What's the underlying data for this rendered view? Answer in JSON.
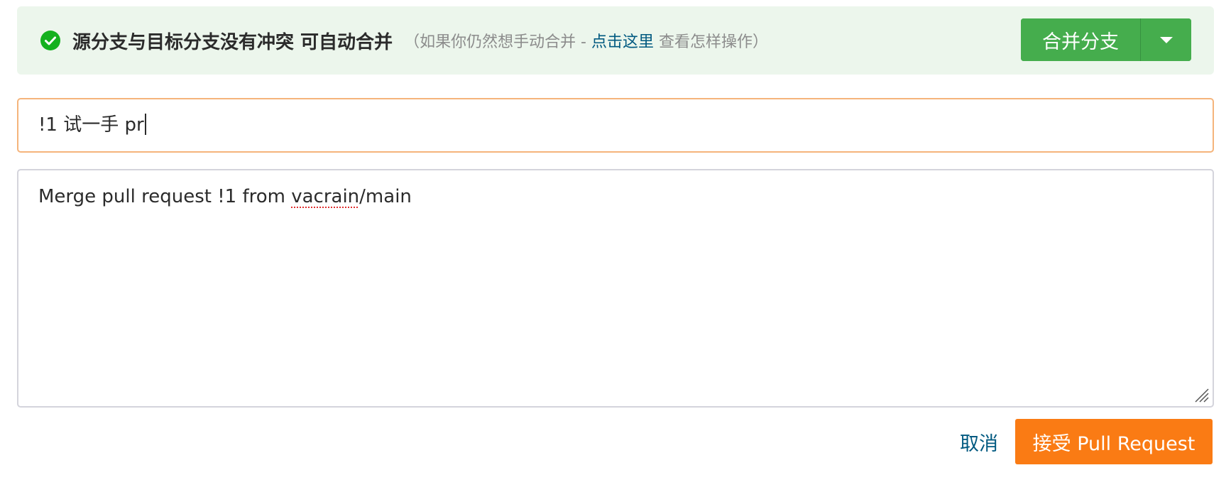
{
  "colors": {
    "banner_bg": "#ecf6ec",
    "success_green": "#45ad4d",
    "check_icon_green": "#14b11e",
    "link_blue": "#005980",
    "accent_orange": "#fa7b14",
    "focus_border": "#f5b47b"
  },
  "banner": {
    "icon": "check-circle-icon",
    "title": "源分支与目标分支没有冲突 可自动合并",
    "hint_prefix": "（如果你仍然想手动合并 - ",
    "hint_link": "点击这里",
    "hint_suffix": " 查看怎样操作）",
    "merge_button_label": "合并分支",
    "dropdown_icon": "caret-down-icon"
  },
  "form": {
    "title_value": "!1 试一手 pr",
    "body_prefix": "Merge pull request !1 from ",
    "body_misspelled": "vacrain",
    "body_suffix": "/main",
    "resize_icon": "resize-handle-icon"
  },
  "actions": {
    "cancel_label": "取消",
    "accept_label": "接受 Pull Request"
  }
}
